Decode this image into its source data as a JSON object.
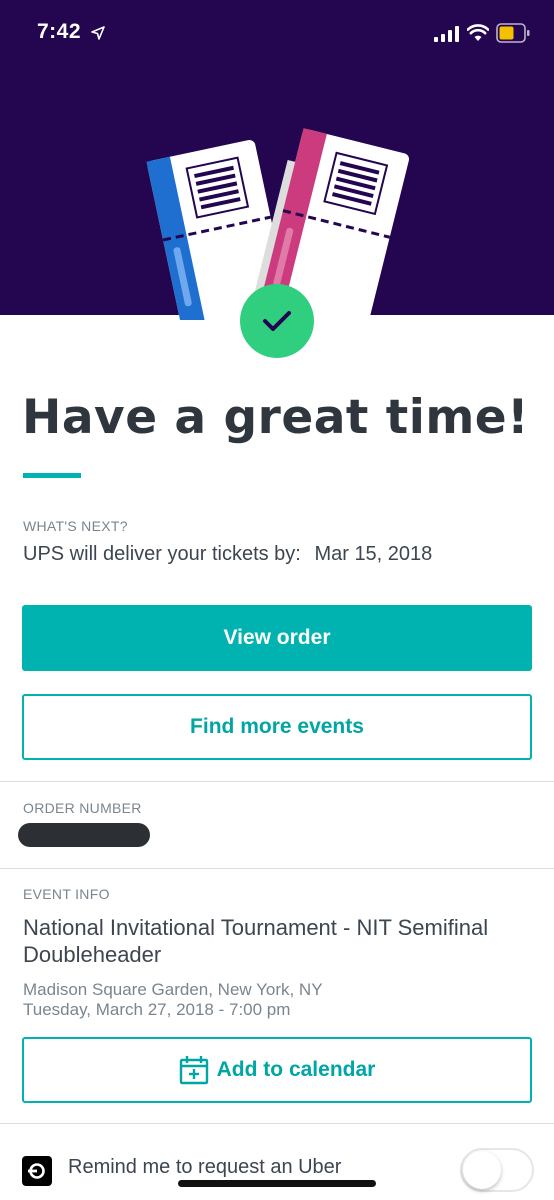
{
  "status_bar": {
    "time": "7:42",
    "battery_color": "#f5c000"
  },
  "hero": {
    "background": "#23064f",
    "icon": "tickets-illustration"
  },
  "confirmation": {
    "icon": "checkmark-icon",
    "badge_color": "#2fcf7f",
    "headline": "Have a great time!"
  },
  "whats_next": {
    "label": "WHAT'S NEXT?",
    "delivery_text": "UPS will deliver your tickets by:",
    "delivery_date": "Mar 15, 2018"
  },
  "actions": {
    "view_order": "View order",
    "find_events": "Find more events"
  },
  "order": {
    "label": "ORDER NUMBER"
  },
  "event": {
    "label": "EVENT INFO",
    "title": "National Invitational Tournament - NIT Semifinal Doubleheader",
    "venue": "Madison Square Garden, New York, NY",
    "datetime": "Tuesday, March 27, 2018 - 7:00 pm",
    "add_calendar": "Add to calendar"
  },
  "uber": {
    "label": "Remind me to request an Uber",
    "toggle_on": false
  },
  "colors": {
    "accent": "#00b3b0",
    "text": "#3d4650",
    "muted": "#7b858f"
  }
}
